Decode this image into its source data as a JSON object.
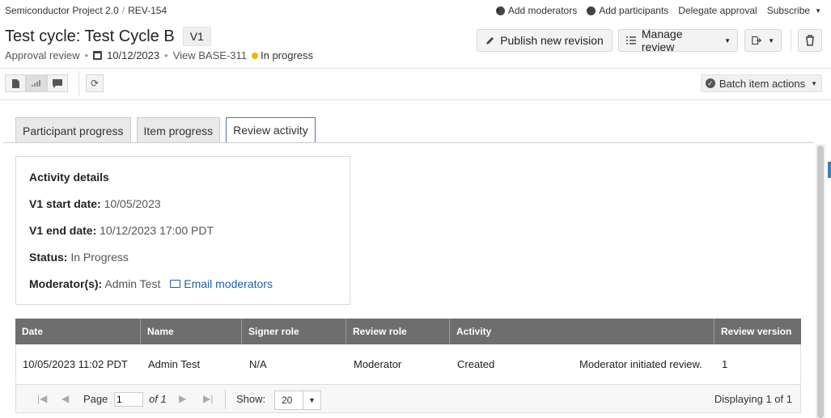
{
  "breadcrumb": {
    "project": "Semiconductor Project 2.0",
    "item": "REV-154"
  },
  "top_links": {
    "add_moderators": "Add moderators",
    "add_participants": "Add participants",
    "delegate": "Delegate approval",
    "subscribe": "Subscribe"
  },
  "header": {
    "title": "Test cycle: Test Cycle B",
    "version": "V1",
    "review_type": "Approval review",
    "date": "10/12/2023",
    "view_link": "View BASE-311",
    "status": "In progress"
  },
  "actions": {
    "publish": "Publish new revision",
    "manage": "Manage review"
  },
  "toolbar": {
    "batch": "Batch item actions"
  },
  "tabs": [
    {
      "label": "Participant progress"
    },
    {
      "label": "Item progress"
    },
    {
      "label": "Review activity"
    }
  ],
  "details": {
    "heading": "Activity details",
    "start_label": "V1 start date:",
    "start_value": "10/05/2023",
    "end_label": "V1 end date:",
    "end_value": "10/12/2023 17:00 PDT",
    "status_label": "Status:",
    "status_value": "In Progress",
    "moderator_label": "Moderator(s):",
    "moderator_value": "Admin Test",
    "email_link": "Email moderators"
  },
  "table": {
    "columns": [
      "Date",
      "Name",
      "Signer role",
      "Review role",
      "Activity",
      "Review version"
    ],
    "rows": [
      {
        "date": "10/05/2023 11:02 PDT",
        "name": "Admin Test",
        "signer_role": "N/A",
        "review_role": "Moderator",
        "activity": "Created",
        "detail": "Moderator initiated review.",
        "version": "1"
      }
    ]
  },
  "pager": {
    "page_label": "Page",
    "page_value": "1",
    "of_label": "of 1",
    "show_label": "Show:",
    "show_value": "20",
    "displaying": "Displaying 1 of 1"
  }
}
